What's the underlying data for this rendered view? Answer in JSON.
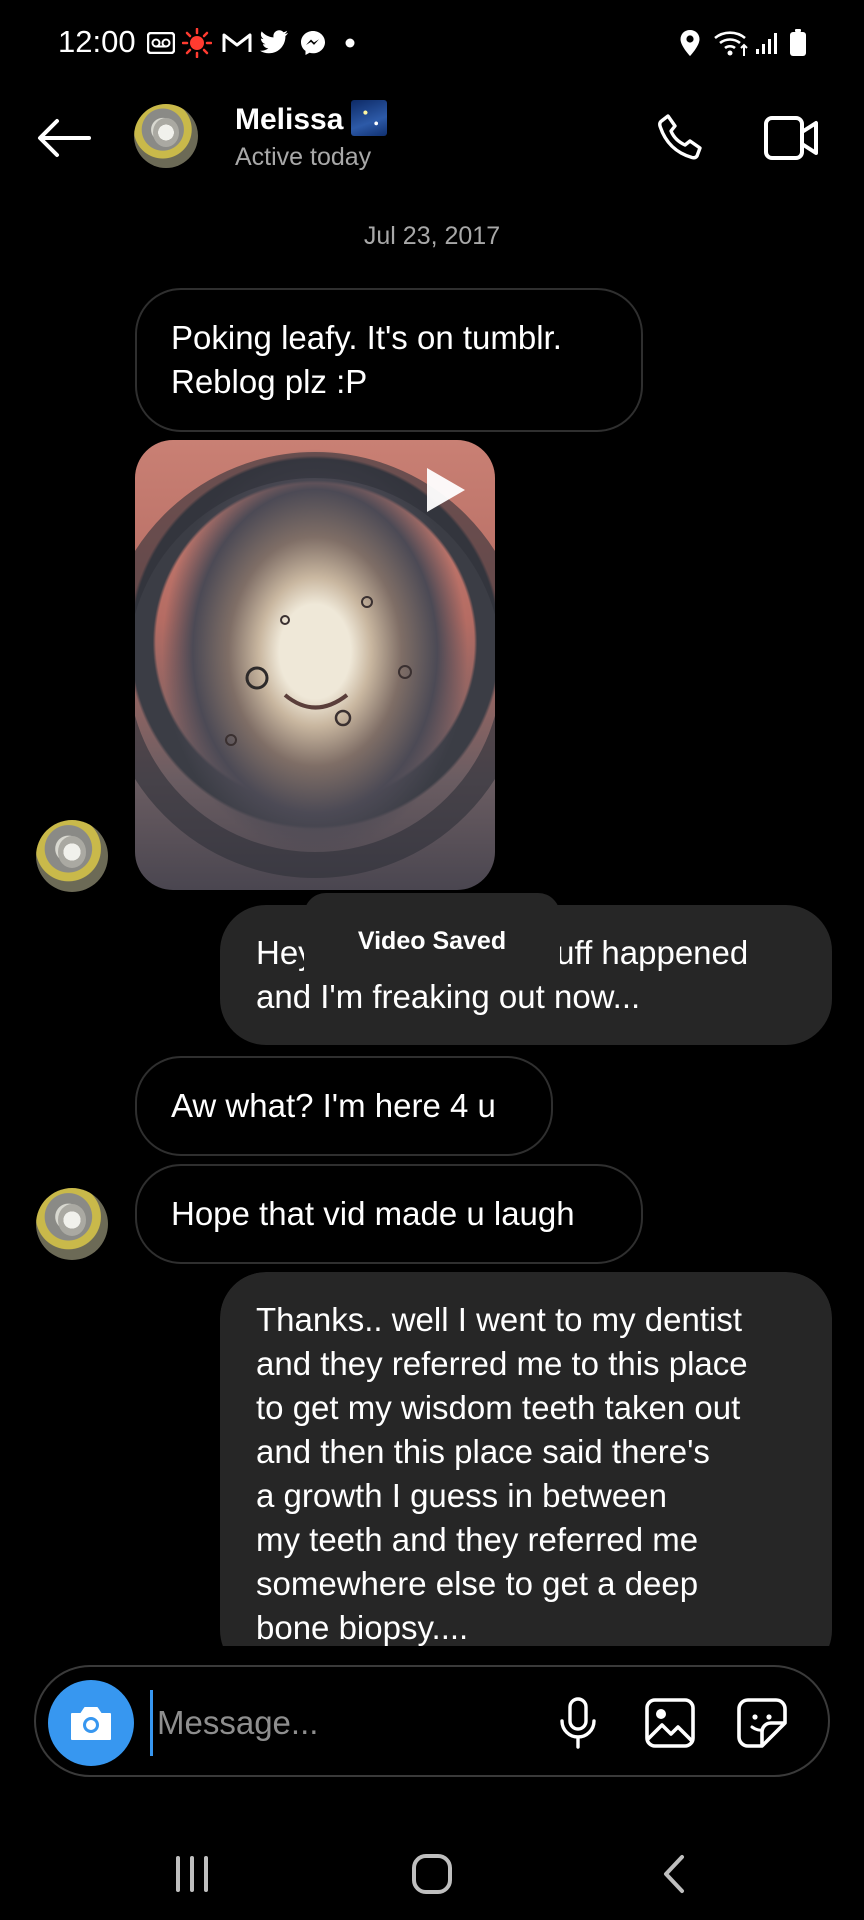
{
  "status_bar": {
    "time": "12:00",
    "left_icons": [
      "voicemail-icon",
      "record-icon",
      "gmail-icon",
      "twitter-icon",
      "messenger-icon",
      "dot-icon"
    ],
    "right_icons": [
      "location-icon",
      "wifi-icon",
      "signal-icon",
      "battery-icon"
    ]
  },
  "header": {
    "contact_name": "Melissa",
    "contact_status": "Active today",
    "actions": [
      "phone-icon",
      "video-call-icon"
    ]
  },
  "thread": {
    "date_separator": "Jul 23, 2017",
    "messages": [
      {
        "from": "them",
        "type": "text",
        "lines": [
          "Poking leafy. It's on tumblr.",
          "Reblog plz :P"
        ]
      },
      {
        "from": "them",
        "type": "video"
      },
      {
        "from": "me",
        "type": "text",
        "lines": [
          "Hey sorry.. a lot of stuff happened",
          "and I'm freaking out now..."
        ]
      },
      {
        "from": "them",
        "type": "text",
        "lines": [
          "Aw what? I'm here 4 u"
        ]
      },
      {
        "from": "them",
        "type": "text",
        "lines": [
          "Hope that vid made u laugh"
        ]
      },
      {
        "from": "me",
        "type": "text",
        "lines": [
          "Thanks.. well I went to my dentist",
          "and they referred me to this place",
          "to get my wisdom teeth taken out",
          "and then this place said there's",
          "a growth I guess in between",
          "my teeth and they referred me",
          "somewhere else to get a deep",
          "bone biopsy...."
        ]
      }
    ],
    "toast": "Video Saved"
  },
  "composer": {
    "placeholder": "Message...",
    "icons": [
      "camera-icon",
      "microphone-icon",
      "gallery-icon",
      "sticker-icon"
    ]
  },
  "colors": {
    "background": "#000000",
    "outgoing_bubble": "#262626",
    "incoming_border": "#2f2f2f",
    "accent": "#3797f0",
    "muted_text": "#a8a8a8"
  }
}
